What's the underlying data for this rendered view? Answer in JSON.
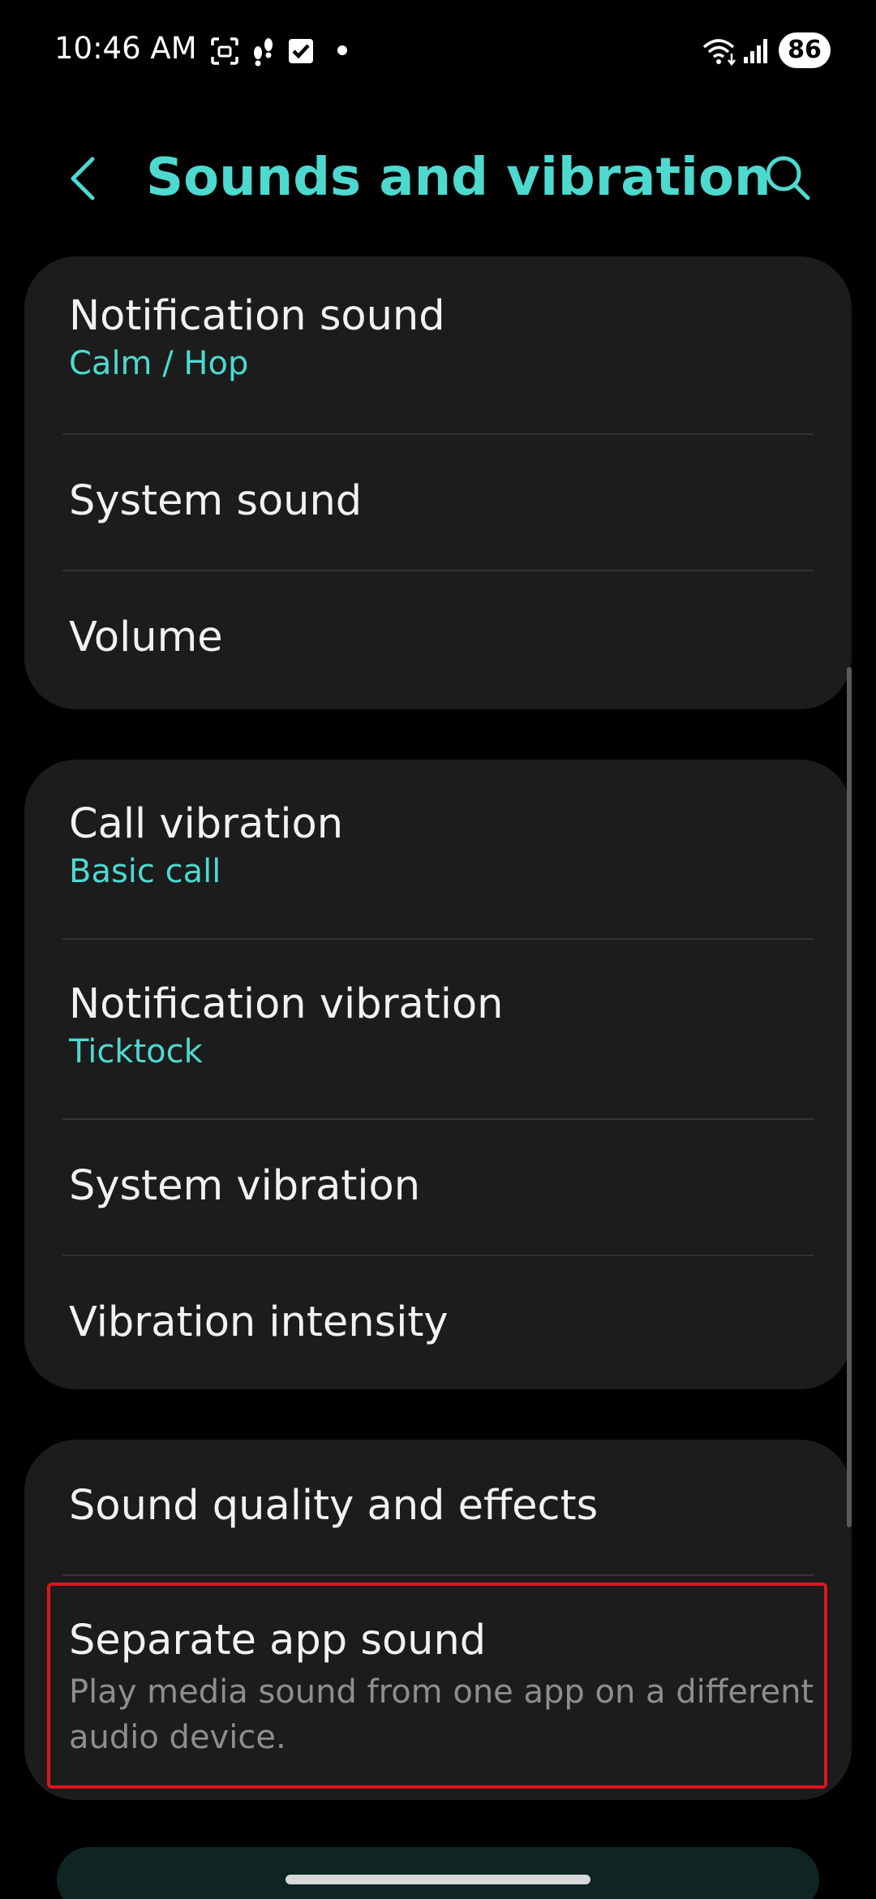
{
  "status_bar": {
    "time": "10:46 AM",
    "battery": "86",
    "icons": [
      "screen-capture-icon",
      "footprints-icon",
      "checkbox-icon",
      "notification-dot-icon",
      "wifi-icon",
      "signal-icon",
      "battery-icon"
    ]
  },
  "header": {
    "title": "Sounds and vibration",
    "back_icon": "chevron-left-icon",
    "search_icon": "search-icon"
  },
  "groups": [
    {
      "items": [
        {
          "title": "Notification sound",
          "subtitle": "Calm / Hop"
        },
        {
          "title": "System sound"
        },
        {
          "title": "Volume"
        }
      ]
    },
    {
      "items": [
        {
          "title": "Call vibration",
          "subtitle": "Basic call"
        },
        {
          "title": "Notification vibration",
          "subtitle": "Ticktock"
        },
        {
          "title": "System vibration"
        },
        {
          "title": "Vibration intensity"
        }
      ]
    },
    {
      "items": [
        {
          "title": "Sound quality and effects"
        },
        {
          "title": "Separate app sound",
          "description": "Play media sound from one app on a different audio device."
        }
      ]
    }
  ],
  "colors": {
    "accent": "#4ed9cf",
    "card_bg": "#1c1c1c",
    "background": "#000000",
    "highlight_border": "#e0141e",
    "description_text": "#8e8e8e"
  }
}
